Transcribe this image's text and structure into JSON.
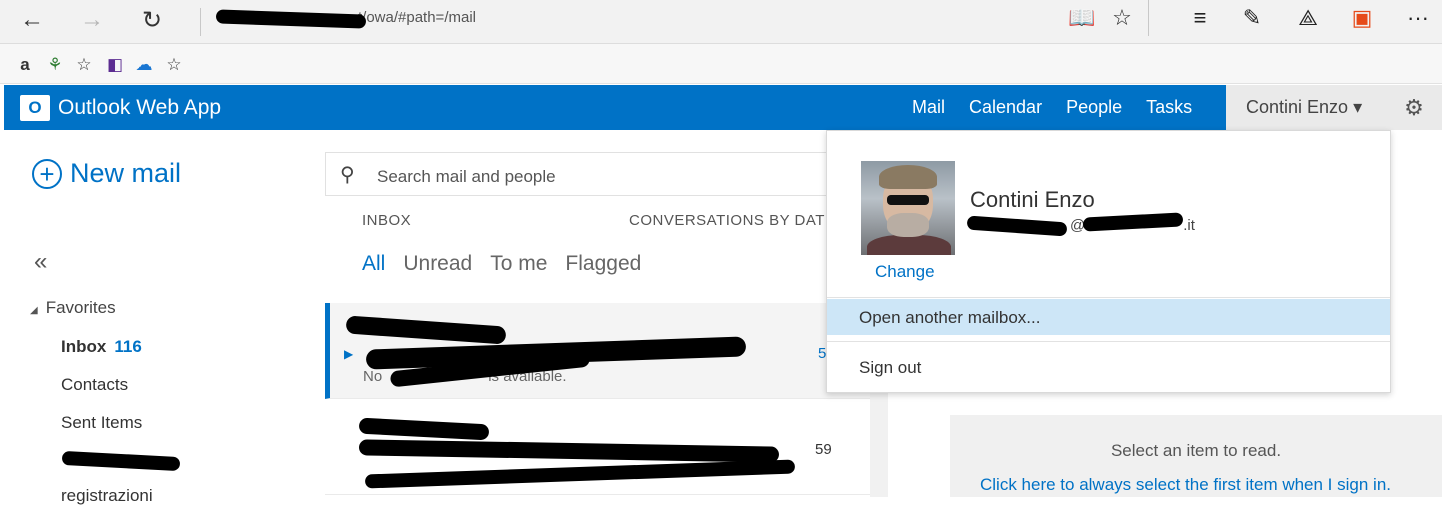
{
  "browser": {
    "url": "t/owa/#path=/mail",
    "back_icon": "←",
    "forward_icon": "→",
    "refresh_icon": "↻",
    "reading_view_icon": "📖",
    "favorite_icon": "☆",
    "hub_icon": "≡",
    "note_icon": "✎",
    "share_icon": "⟁",
    "office_icon": "▣",
    "more_icon": "···",
    "favorites_bar": [
      "a",
      "⚘",
      "☆",
      "◧",
      "☁",
      "☆"
    ]
  },
  "owa": {
    "logo_letter": "O",
    "app_title": "Outlook Web App",
    "nav": [
      "Mail",
      "Calendar",
      "People",
      "Tasks"
    ],
    "user_name": "Contini Enzo",
    "user_caret": "▾",
    "gear": "⚙"
  },
  "left": {
    "new_mail_plus": "+",
    "new_mail": "New mail",
    "collapse": "«",
    "favorites_caret": "◢",
    "favorites": "Favorites",
    "folders": [
      {
        "name": "Inbox",
        "count": "116"
      },
      {
        "name": "Contacts"
      },
      {
        "name": "Sent Items"
      },
      {
        "name": "registrazioni"
      }
    ]
  },
  "middle": {
    "search_icon": "⚲",
    "search_placeholder": "Search mail and people",
    "inbox_label": "INBOX",
    "sort_label": "CONVERSATIONS BY DATE",
    "filters": [
      "All",
      "Unread",
      "To me",
      "Flagged"
    ],
    "items": [
      {
        "preview": "No",
        "preview_tail": "is available.",
        "date": "5"
      },
      {
        "date": "59"
      }
    ]
  },
  "reading": {
    "message": "Select an item to read.",
    "link": "Click here to always select the first item when I sign in."
  },
  "dropdown": {
    "name": "Contini Enzo",
    "email_tail": "@",
    "email_domain": ".it",
    "change": "Change",
    "open_another": "Open another mailbox...",
    "sign_out": "Sign out"
  }
}
